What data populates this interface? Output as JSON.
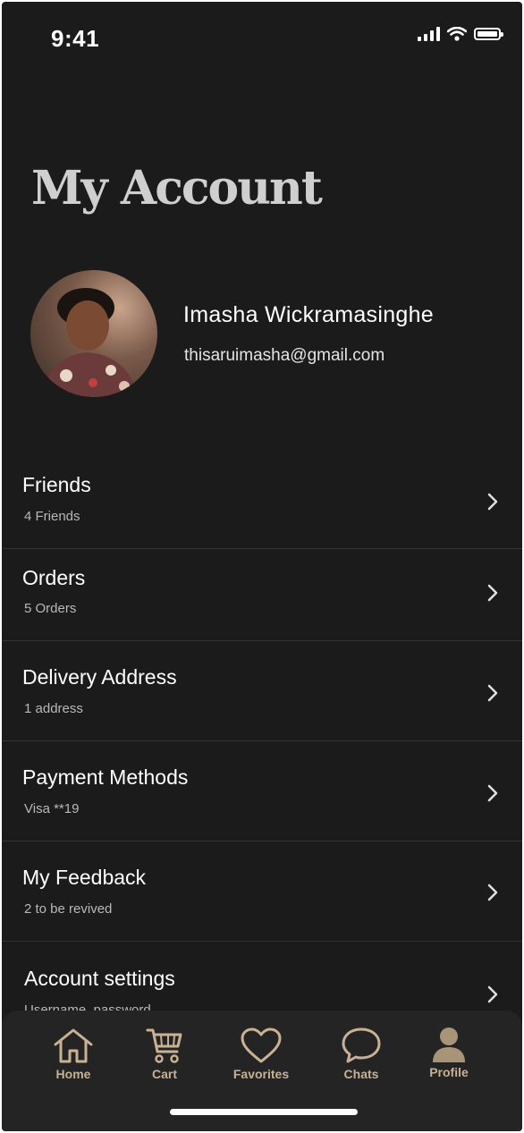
{
  "status_bar": {
    "time": "9:41"
  },
  "header": {
    "title": "My Account"
  },
  "profile": {
    "name": "Imasha Wickramasinghe",
    "email": "thisaruimasha@gmail.com"
  },
  "menu": [
    {
      "title": "Friends",
      "subtitle": "4 Friends"
    },
    {
      "title": "Orders",
      "subtitle": "5 Orders"
    },
    {
      "title": "Delivery Address",
      "subtitle": "1 address"
    },
    {
      "title": "Payment Methods",
      "subtitle": "Visa **19"
    },
    {
      "title": "My Feedback",
      "subtitle": "2 to be revived"
    },
    {
      "title": "Account settings",
      "subtitle": "Username, password"
    }
  ],
  "tabs": [
    {
      "label": "Home",
      "icon": "home-icon"
    },
    {
      "label": "Cart",
      "icon": "cart-icon"
    },
    {
      "label": "Favorites",
      "icon": "heart-icon"
    },
    {
      "label": "Chats",
      "icon": "chat-bubble-icon"
    },
    {
      "label": "Profile",
      "icon": "profile-icon",
      "active": true
    }
  ],
  "colors": {
    "background": "#1b1b1b",
    "tab_accent": "#c9b293",
    "title": "#cfcfcf"
  }
}
